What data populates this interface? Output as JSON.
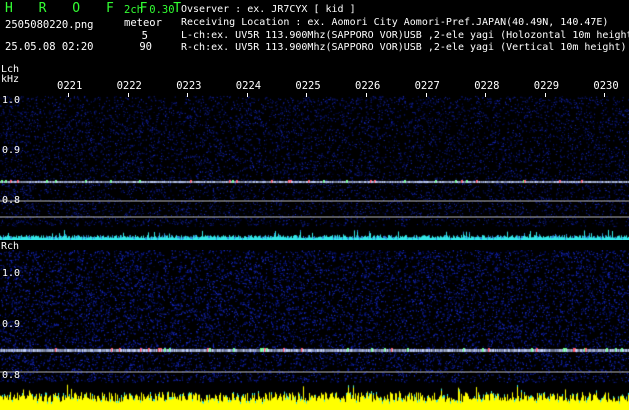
{
  "header": {
    "logo": "H R O F F T",
    "version": "2ch 0.30",
    "filename": "2505080220.png",
    "meteor_label": "meteor",
    "meteor_count_l": "5",
    "meteor_count_r": "90",
    "datetime": "25.05.08 02:20",
    "observer": "Ovserver            : ex. JR7CYX [ kid ]",
    "location": "Receiving Location : ex. Aomori City Aomori-Pref.JAPAN(40.49N, 140.47E)",
    "lch_desc": "L-ch:ex. UV5R 113.900Mhz(SAPPORO VOR)USB ,2-ele yagi (Holozontal 10m height)",
    "rch_desc": "R-ch:ex. UV5R 113.900Mhz(SAPPORO VOR)USB ,2-ele yagi (Vertical 10m height)"
  },
  "lch": {
    "title": "Lch",
    "unit": "kHz",
    "y_labels": [
      "1.0",
      "0.9",
      "0.8"
    ],
    "time_labels": [
      "0221",
      "0222",
      "0223",
      "0224",
      "0225",
      "0226",
      "0227",
      "0228",
      "0229",
      "0230"
    ]
  },
  "rch": {
    "title": "Rch",
    "y_labels": [
      "1.0",
      "0.9",
      "0.8"
    ]
  },
  "colors": {
    "background": "#000000",
    "noise": "#0a1a8a",
    "carrier": "#cfd8ff",
    "level_l": "#33e6e6",
    "level_r": "#ffff00",
    "logo": "#33ff33"
  }
}
